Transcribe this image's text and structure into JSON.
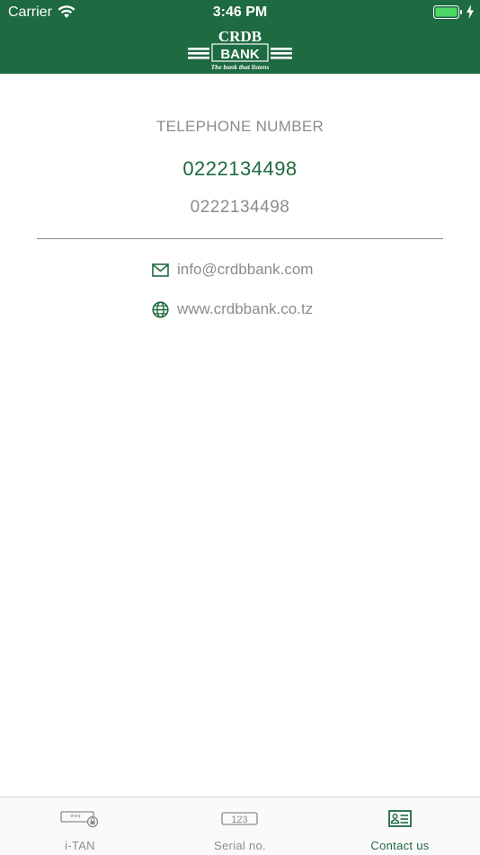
{
  "status_bar": {
    "carrier": "Carrier",
    "time": "3:46 PM"
  },
  "header": {
    "logo_text": "CRDB",
    "logo_bank": "BANK",
    "tagline": "The bank that listens",
    "background_color": "#1e6a41"
  },
  "contact": {
    "telephone_label": "TELEPHONE NUMBER",
    "telephone_primary": "0222134498",
    "telephone_secondary": "0222134498",
    "email": "info@crdbbank.com",
    "website": "www.crdbbank.co.tz",
    "accent_color": "#1e6a41"
  },
  "tabbar": {
    "tabs": [
      {
        "label": "i-TAN",
        "icon": "password-lock-icon",
        "active": false
      },
      {
        "label": "Serial no.",
        "icon": "serial-number-icon",
        "active": false
      },
      {
        "label": "Contact us",
        "icon": "contact-card-icon",
        "active": true
      }
    ]
  }
}
